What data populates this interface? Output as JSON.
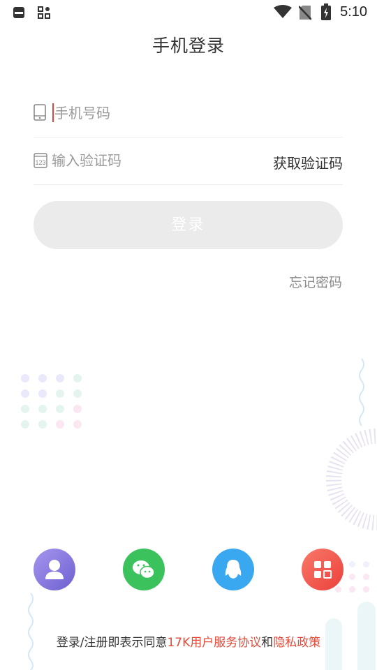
{
  "status_bar": {
    "time": "5:10",
    "icons": [
      "carrier-app-icon",
      "apps-grid-icon",
      "wifi-icon",
      "no-sim-icon",
      "battery-charging-icon"
    ]
  },
  "header": {
    "title": "手机登录"
  },
  "form": {
    "phone": {
      "placeholder": "手机号码",
      "value": "",
      "icon": "phone-icon"
    },
    "code": {
      "placeholder": "输入验证码",
      "value": "",
      "icon": "numeric-123-icon",
      "get_code_label": "获取验证码"
    },
    "login_label": "登录",
    "forgot_label": "忘记密码"
  },
  "social_logins": [
    {
      "name": "account",
      "icon": "person-icon",
      "color": "#8d7ee0"
    },
    {
      "name": "wechat",
      "icon": "wechat-icon",
      "color": "#3cc25c"
    },
    {
      "name": "qq",
      "icon": "qq-penguin-icon",
      "color": "#3aa8f0"
    },
    {
      "name": "more",
      "icon": "grid-apps-icon",
      "color": "#f0544a"
    }
  ],
  "agreement": {
    "prefix": "登录/注册即表示同意",
    "terms_link": "17K用户服务协议",
    "and": "和",
    "privacy_link": "隐私政策",
    "link_color": "#e34a3a"
  }
}
